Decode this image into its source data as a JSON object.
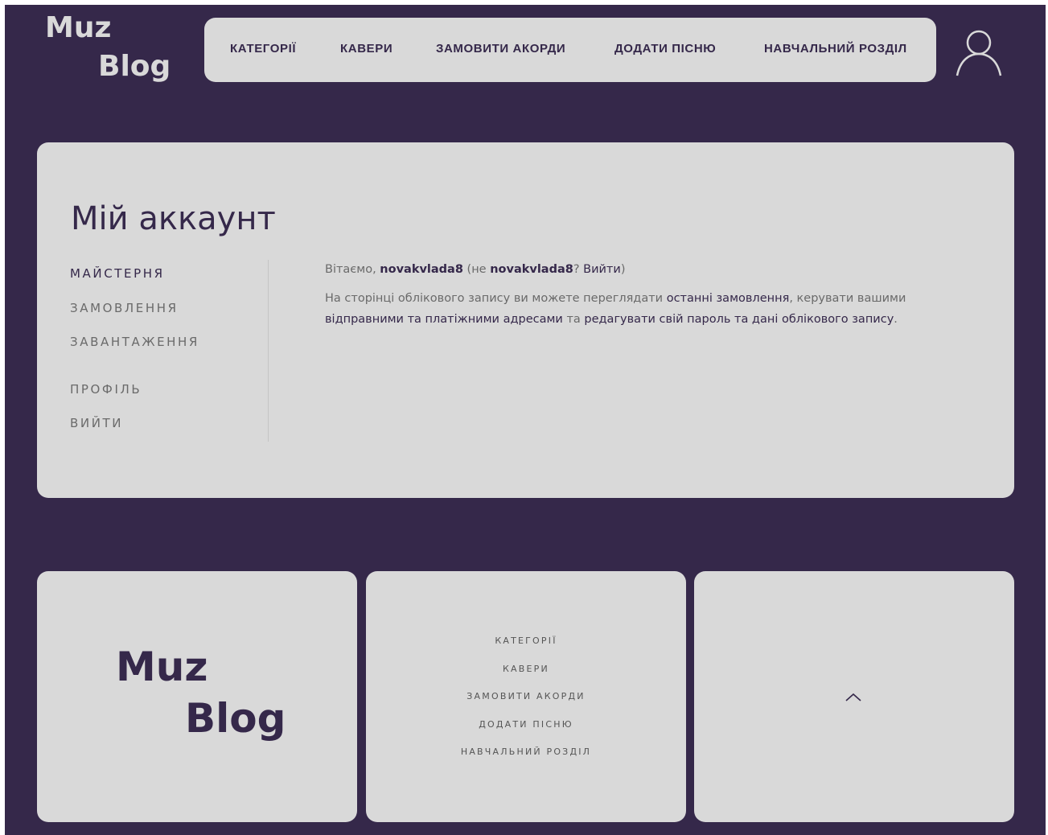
{
  "header": {
    "logo_line1": "Muz",
    "logo_line2": "Blog",
    "nav": [
      "КАТЕГОРІЇ",
      "КАВЕРИ",
      "ЗАМОВИТИ АКОРДИ",
      "ДОДАТИ ПІСНЮ",
      "НАВЧАЛЬНИЙ РОЗДІЛ"
    ],
    "user_icon": "user-icon"
  },
  "account": {
    "title": "Мій аккаунт",
    "menu": [
      "МАЙСТЕРНЯ",
      "ЗАМОВЛЕННЯ",
      "ЗАВАНТАЖЕННЯ",
      "ПРОФІЛЬ",
      "ВИЙТИ"
    ],
    "greeting": {
      "prefix": "Вітаємо, ",
      "username": "novakvlada8",
      "middle": " (не ",
      "username2": "novakvlada8",
      "question": "? ",
      "logout": "Вийти",
      "suffix": ")"
    },
    "description": {
      "part1": "На сторінці облікового запису ви можете переглядати ",
      "link1": "останні замовлення",
      "part2": ", керувати вашими ",
      "link2": "відправними та платіжними адресами",
      "part3": " та ",
      "link3": "редагувати свій пароль та дані облікового запису",
      "part4": "."
    }
  },
  "footer": {
    "logo_line1": "Muz",
    "logo_line2": "Blog",
    "nav": [
      "КАТЕГОРІЇ",
      "КАВЕРИ",
      "ЗАМОВИТИ АКОРДИ",
      "ДОДАТИ ПІСНЮ",
      "НАВЧАЛЬНИЙ РОЗДІЛ"
    ],
    "scroll_icon": "chevron-up-icon"
  },
  "colors": {
    "background": "#35284a",
    "card": "#d9d9d9",
    "accent": "#35284a",
    "muted_text": "#6a6a6a"
  }
}
